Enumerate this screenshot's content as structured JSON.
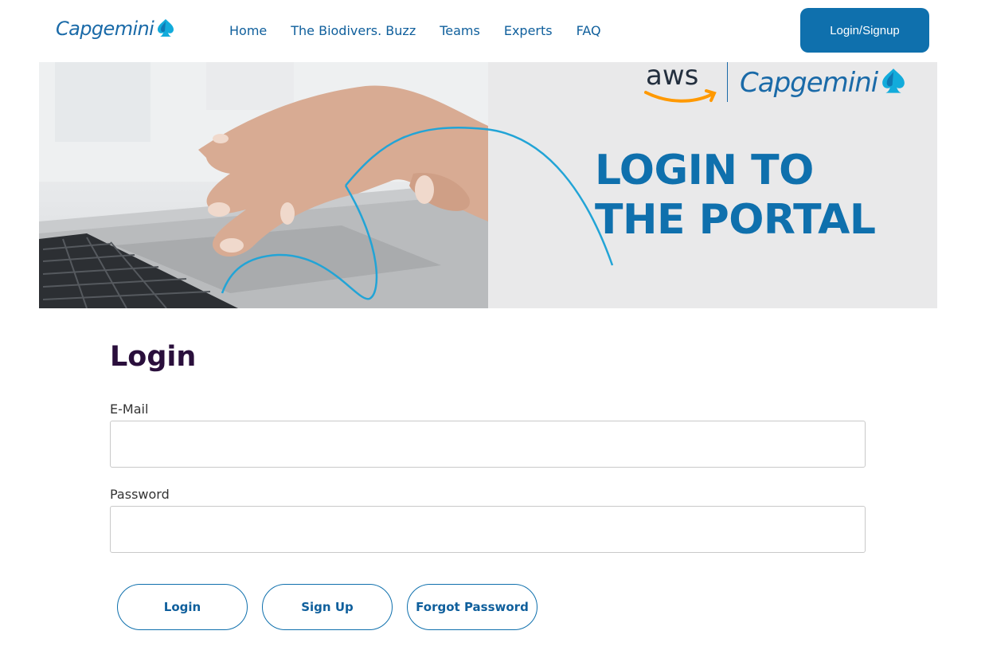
{
  "header": {
    "logo_text": "Capgemini",
    "nav": [
      {
        "label": "Home"
      },
      {
        "label": "The Biodivers. Buzz"
      },
      {
        "label": "Teams"
      },
      {
        "label": "Experts"
      },
      {
        "label": "FAQ"
      }
    ],
    "login_signup_label": "Login/Signup"
  },
  "hero": {
    "aws_logo_text": "aws",
    "partner_logo_text": "Capgemini",
    "title_line1": "LOGIN TO",
    "title_line2": "THE PORTAL"
  },
  "form": {
    "title": "Login",
    "email": {
      "label": "E-Mail",
      "value": "",
      "placeholder": ""
    },
    "password": {
      "label": "Password",
      "value": "",
      "placeholder": ""
    },
    "buttons": {
      "login": "Login",
      "signup": "Sign Up",
      "forgot": "Forgot Password"
    }
  },
  "colors": {
    "brand_blue": "#0f70ad",
    "title_purple": "#2a0f3c",
    "hero_background": "#e9e9ea"
  }
}
